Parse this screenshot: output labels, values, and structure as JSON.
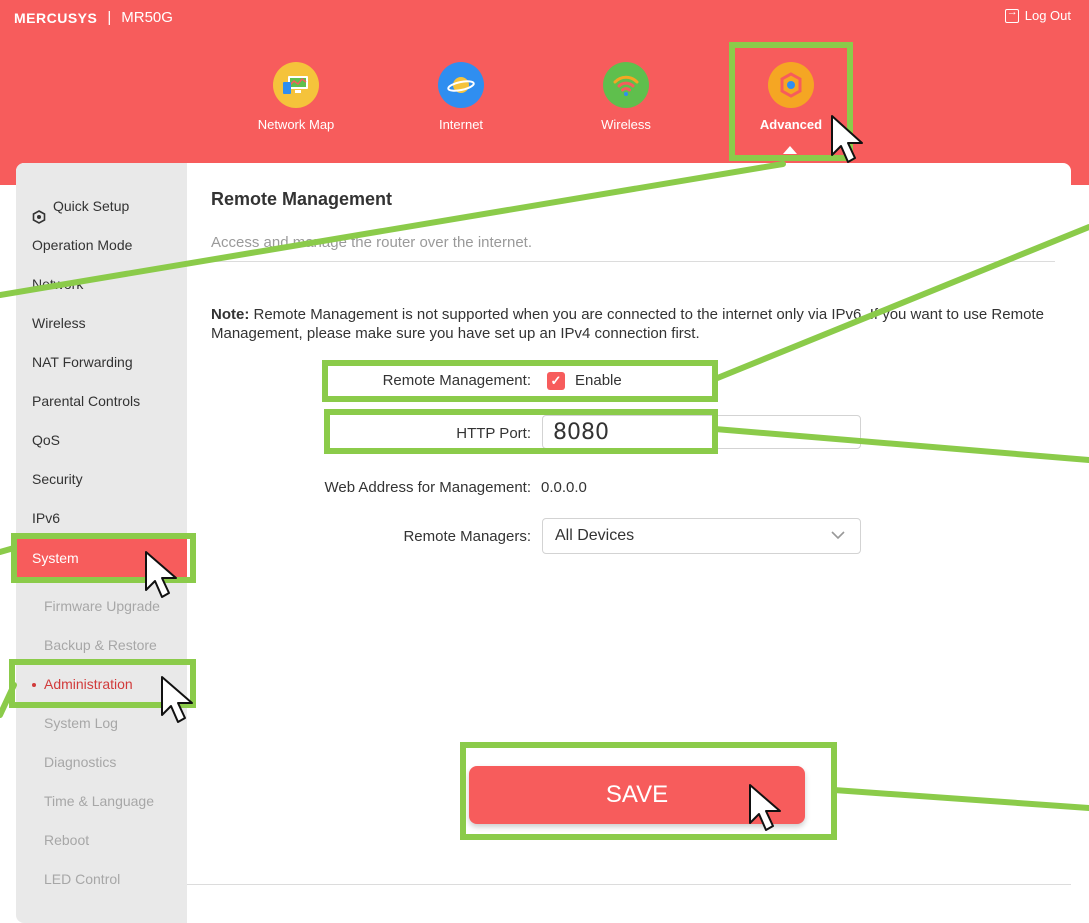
{
  "header": {
    "brand": "MERCUSYS",
    "separator": "|",
    "model": "MR50G",
    "logout_label": "Log Out"
  },
  "nav": [
    {
      "label": "Network Map",
      "icon": "network-map-icon",
      "color": "#f5c33b"
    },
    {
      "label": "Internet",
      "icon": "internet-globe-icon",
      "color": "#2f8ef0"
    },
    {
      "label": "Wireless",
      "icon": "wifi-icon",
      "color": "#5fbf4d"
    },
    {
      "label": "Advanced",
      "icon": "gear-icon",
      "color": "#f5a623"
    }
  ],
  "sidebar": {
    "quick_setup": "Quick Setup",
    "items": [
      "Operation Mode",
      "Network",
      "Wireless",
      "NAT Forwarding",
      "Parental Controls",
      "QoS",
      "Security",
      "IPv6",
      "System"
    ],
    "sub_items": [
      "Firmware Upgrade",
      "Backup & Restore",
      "Administration",
      "System Log",
      "Diagnostics",
      "Time & Language",
      "Reboot",
      "LED Control"
    ]
  },
  "content": {
    "title": "Remote Management",
    "description": "Access and manage the router over the internet.",
    "note_label": "Note:",
    "note_text": "Remote Management is not supported when you are connected to the internet only via IPv6. If you want to use Remote Management, please make sure you have set up an IPv4 connection first.",
    "remote_management_label": "Remote Management:",
    "enable_label": "Enable",
    "enable_checked": true,
    "http_port_label": "HTTP Port:",
    "http_port_value": "8080",
    "web_address_label": "Web Address for Management:",
    "web_address_value": "0.0.0.0",
    "remote_managers_label": "Remote Managers:",
    "remote_managers_value": "All Devices",
    "save_label": "SAVE"
  },
  "colors": {
    "accent": "#f75c5c",
    "highlight": "#8bcb4a",
    "sidebar_bg": "#e9e9e9"
  }
}
